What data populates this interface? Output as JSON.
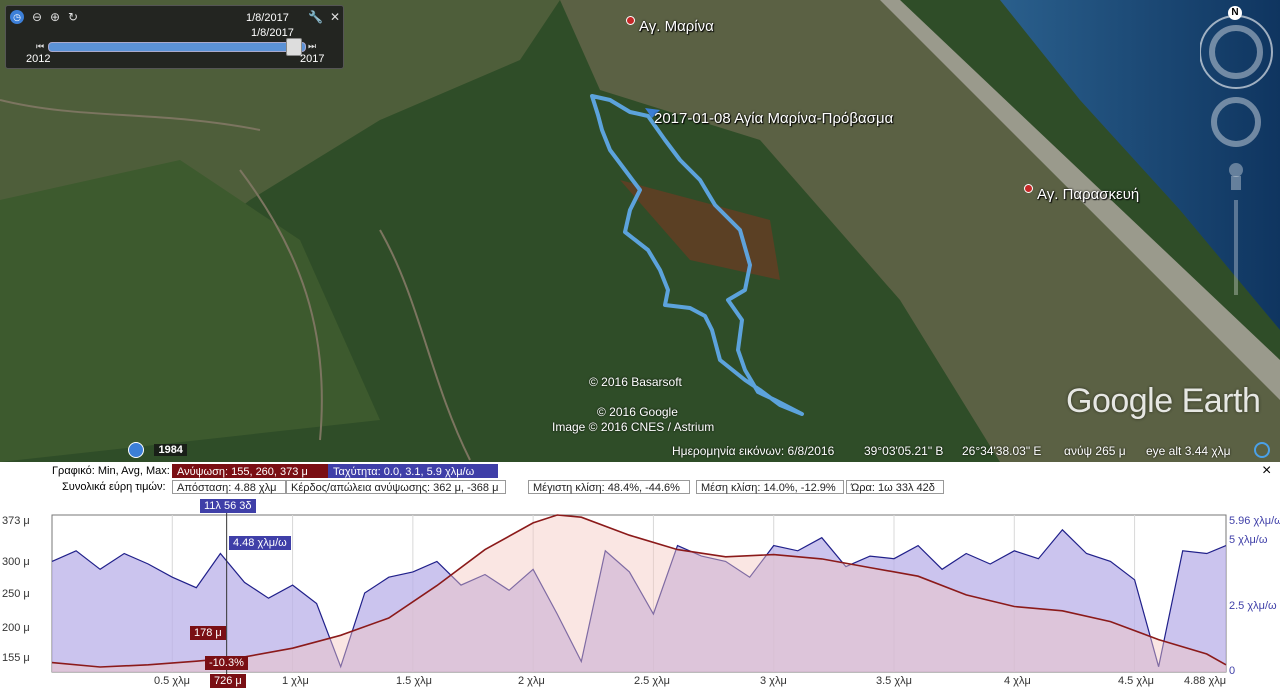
{
  "timeslider": {
    "current_date": "1/8/2017",
    "tooltip_date": "1/8/2017",
    "start_year": "2012",
    "end_year": "2017",
    "zoom_out_icon": "zoom-out-icon",
    "zoom_in_icon": "zoom-in-icon",
    "settings_icon": "wrench-icon",
    "close_icon": "close-icon"
  },
  "map": {
    "places": [
      {
        "name": "Αγ. Μαρίνα"
      },
      {
        "name": "Αγ. Παρασκευή"
      }
    ],
    "track_label": "2017-01-08 Αγία Μαρίνα-Πρόβασμα",
    "credits": [
      "© 2016 Basarsoft",
      "© 2016 Google",
      "Image © 2016 CNES / Astrium"
    ],
    "logo": "Google Earth",
    "history_year": "1984",
    "compass_letter": "N"
  },
  "status": {
    "imagery_date": "Ημερομηνία εικόνων: 6/8/2016",
    "latitude": "39°03'05.21\" Β",
    "longitude": "26°34'38.03\" Ε",
    "elevation": "ανύψ   265 μ",
    "eye_alt": "eye alt   3.44 χλμ"
  },
  "elevation_profile": {
    "row1_label": "Γραφικό: Min, Avg, Max:",
    "elevation_stats": "Ανύψωση: 155, 260, 373 μ",
    "speed_stats": "Ταχύτητα: 0.0, 3.1, 5.9 χλμ/ω",
    "row2_label": "Συνολικά εύρη τιμών:",
    "distance": "Απόσταση: 4.88 χλμ",
    "gain_loss": "Κέρδος/απώλεια ανύψωσης: 362 μ, -368 μ",
    "max_slope": "Μέγιστη κλίση: 48.4%, -44.6%",
    "avg_slope": "Μέση κλίση: 14.0%, -12.9%",
    "time": "Ώρα: 1ω 33λ 42δ",
    "close_label": "×",
    "cursor": {
      "time": "11λ 56 3δ",
      "speed": "4.48 χλμ/ω",
      "elevation": "178 μ",
      "slope": "-10.3%",
      "distance": "726 μ",
      "distance_km": 0.726
    },
    "left_axis_ticks": [
      "373 μ",
      "300 μ",
      "250 μ",
      "200 μ",
      "155 μ"
    ],
    "right_axis_ticks": [
      "5.96 χλμ/ω",
      "5 χλμ/ω",
      "2.5 χλμ/ω",
      "0"
    ],
    "x_axis_ticks": [
      "0.5 χλμ",
      "1 χλμ",
      "1.5 χλμ",
      "2 χλμ",
      "2.5 χλμ",
      "3 χλμ",
      "3.5 χλμ",
      "4 χλμ",
      "4.5 χλμ",
      "4.88 χλμ"
    ],
    "colors": {
      "elevation_line": "#8b1a1a",
      "elevation_fill": "#f4c7c0",
      "speed_line": "#20208a",
      "speed_fill": "#b9b0e8"
    }
  },
  "chart_data": {
    "type": "area",
    "title": "",
    "xlabel": "",
    "ylabel": "",
    "xlim": [
      0,
      4.88
    ],
    "ylim": [
      155,
      373
    ],
    "y2lim": [
      0,
      5.96
    ],
    "series": [
      {
        "name": "Ανύψωση",
        "x": [
          0,
          0.2,
          0.4,
          0.6,
          0.8,
          1.0,
          1.2,
          1.4,
          1.6,
          1.8,
          2.0,
          2.1,
          2.2,
          2.4,
          2.6,
          2.8,
          3.0,
          3.2,
          3.4,
          3.6,
          3.8,
          4.0,
          4.2,
          4.4,
          4.6,
          4.8,
          4.88
        ],
        "values": [
          168,
          162,
          165,
          170,
          176,
          188,
          206,
          230,
          275,
          325,
          362,
          373,
          370,
          345,
          325,
          315,
          318,
          312,
          300,
          288,
          262,
          246,
          240,
          225,
          200,
          180,
          165
        ]
      },
      {
        "name": "Ταχύτητα",
        "x": [
          0,
          0.1,
          0.2,
          0.3,
          0.4,
          0.5,
          0.6,
          0.7,
          0.8,
          0.9,
          1.0,
          1.1,
          1.2,
          1.3,
          1.4,
          1.5,
          1.6,
          1.7,
          1.8,
          1.9,
          2.0,
          2.1,
          2.2,
          2.3,
          2.4,
          2.5,
          2.6,
          2.7,
          2.8,
          2.9,
          3.0,
          3.1,
          3.2,
          3.3,
          3.4,
          3.5,
          3.6,
          3.7,
          3.8,
          3.9,
          4.0,
          4.1,
          4.2,
          4.3,
          4.4,
          4.5,
          4.6,
          4.7,
          4.8,
          4.88
        ],
        "values": [
          4.2,
          4.6,
          3.9,
          4.5,
          4.1,
          3.6,
          3.2,
          4.5,
          3.4,
          2.8,
          3.3,
          2.6,
          0.2,
          3.0,
          3.6,
          3.8,
          4.2,
          3.3,
          3.7,
          3.1,
          3.9,
          2.2,
          0.4,
          4.6,
          3.8,
          2.2,
          4.8,
          4.4,
          4.2,
          3.6,
          4.8,
          4.6,
          5.1,
          4.0,
          4.4,
          4.3,
          4.8,
          3.9,
          4.5,
          4.1,
          4.6,
          4.3,
          5.4,
          4.5,
          4.2,
          3.5,
          0.2,
          4.6,
          4.5,
          4.8
        ]
      }
    ]
  }
}
